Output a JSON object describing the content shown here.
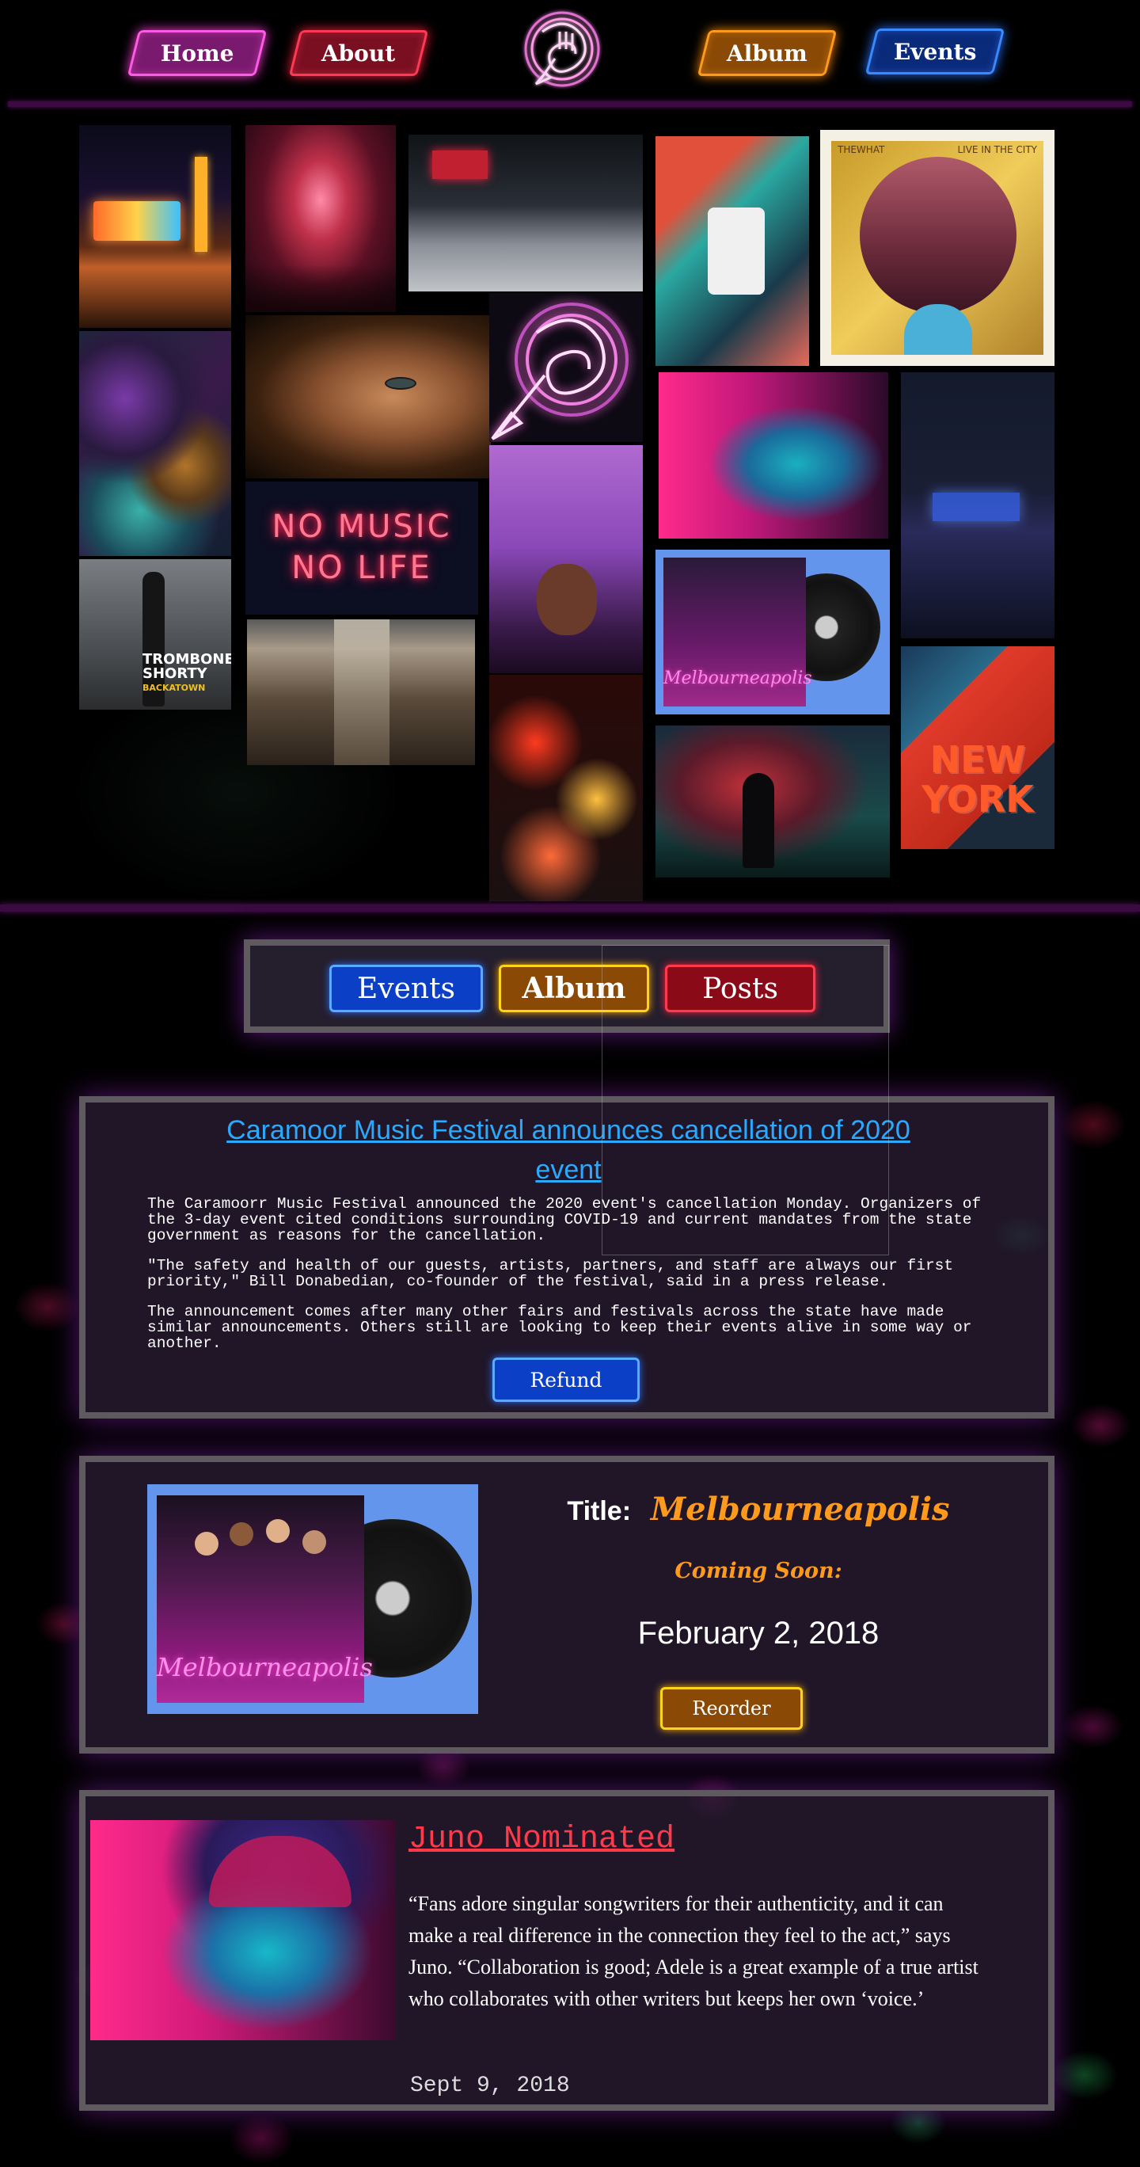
{
  "nav": {
    "home": "Home",
    "about": "About",
    "album": "Album",
    "events": "Events",
    "logo_icon": "neon-trumpet-icon"
  },
  "collage": {
    "no_music_sign": "NO MUSIC",
    "no_life_sign": "NO LIFE",
    "trombone_cover_line1": "TROMBONE",
    "trombone_cover_line2": "SHORTY",
    "trombone_cover_line3": "BACKATOWN",
    "new_york_line1": "NEW",
    "new_york_line2": "YORK",
    "city_cover_left": "THEWHAT",
    "city_cover_right": "LIVE IN THE CITY",
    "melbourneapolis_cover": "Melbourneapolis"
  },
  "tabs": {
    "events": "Events",
    "album": "Album",
    "posts": "Posts"
  },
  "news": {
    "title": "Caramoor Music Festival announces cancellation of 2020 event",
    "paragraphs": [
      "The Caramoorr Music Festival announced the 2020 event's cancellation Monday. Organizers of the 3-day event cited conditions surrounding COVID-19 and current mandates from the state government as reasons for the cancellation.",
      "\"The safety and health of our guests, artists, partners, and staff are always our first priority,\" Bill Donabedian, co-founder of the festival, said in a press release.",
      "The announcement comes after many other fairs and festivals across the state have made similar announcements. Others still are looking to keep their events alive in some way or another."
    ],
    "refund_label": "Refund"
  },
  "album": {
    "title_label": "Title:",
    "title_value": "Melbourneapolis",
    "coming_soon": "Coming Soon:",
    "release_date": "February 2, 2018",
    "reorder_label": "Reorder",
    "cover_text": "Melbourneapolis"
  },
  "juno": {
    "title": "Juno Nominated",
    "quote": "“Fans adore singular songwriters for their authenticity, and it can make a real difference in the connection they feel to the act,” says Juno. “Collaboration is good; Adele is a great example of a true artist who collaborates with other writers but keeps her own ‘voice.’",
    "date": "Sept 9, 2018"
  },
  "colors": {
    "home": "#ff5ce6",
    "about": "#ff3a55",
    "album": "#ff9a1c",
    "events": "#3a8aff",
    "news_title": "#2aa9ff",
    "juno_title": "#ff3a4a"
  }
}
